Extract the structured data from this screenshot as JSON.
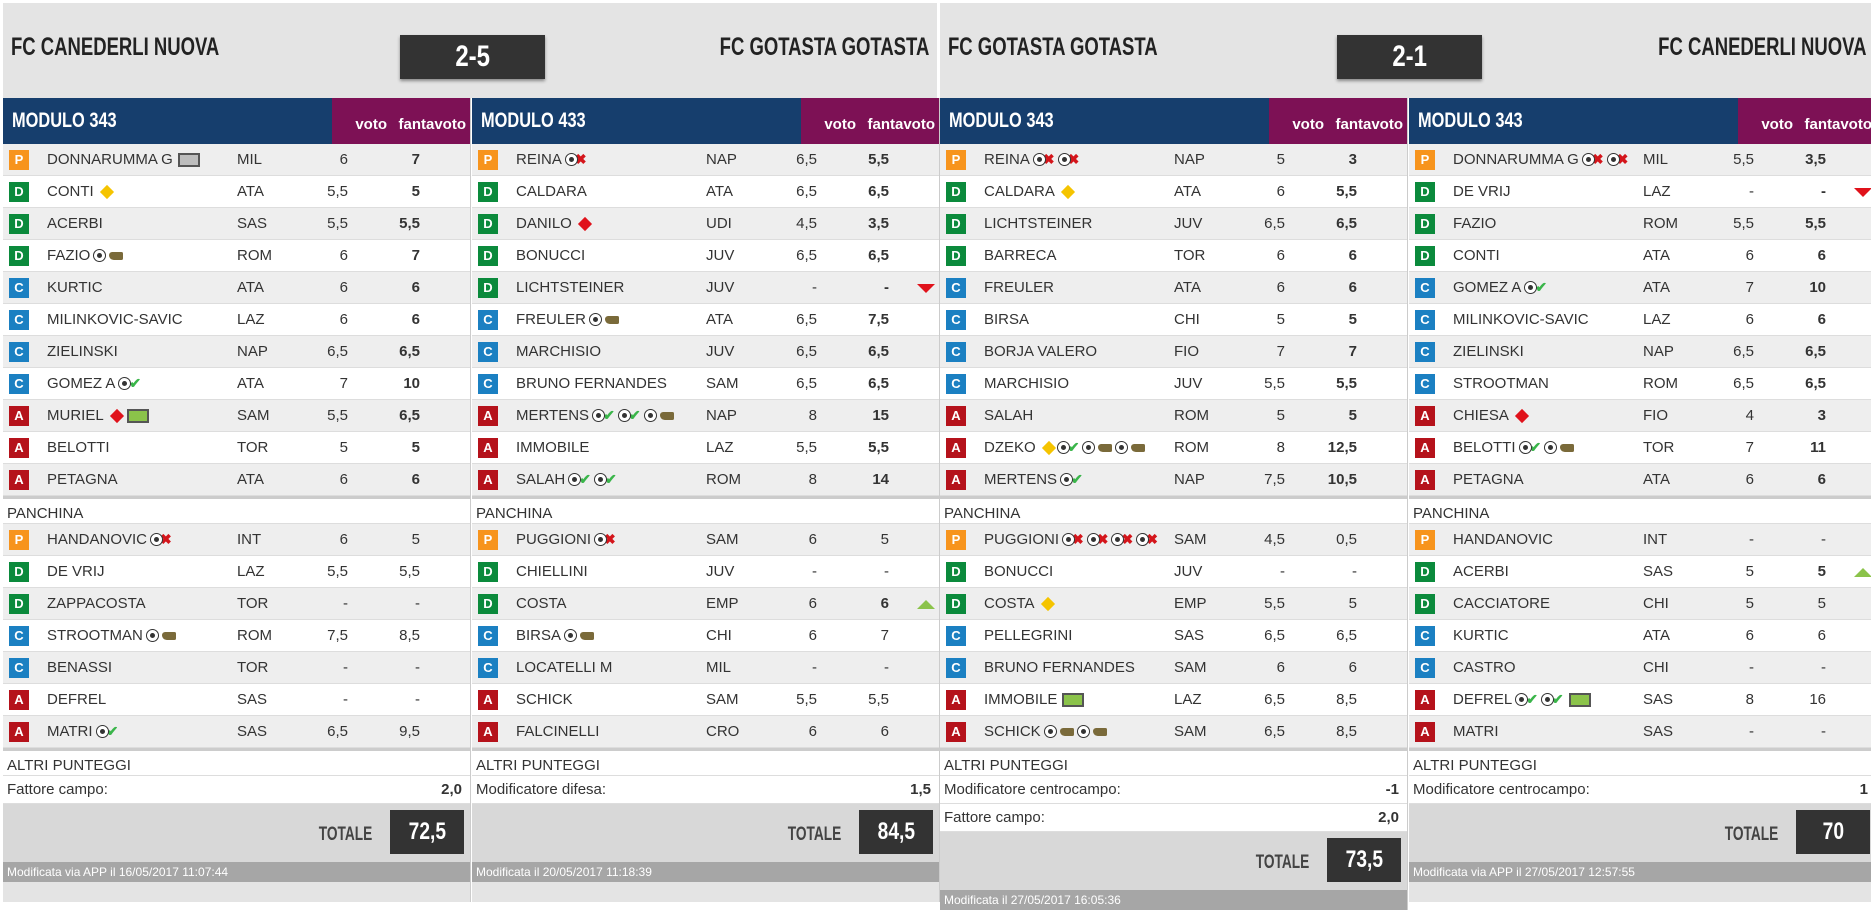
{
  "matches": [
    {
      "home": "FC CANEDERLI NUOVA",
      "away": "FC GOTASTA GOTASTA",
      "score": "2-5",
      "cols": [
        {
          "modulo": "MODULO 343",
          "voto_h": "voto",
          "fv_h": "fantavoto",
          "starters": [
            {
              "r": "P",
              "n": "DONNARUMMA G",
              "ic": [
                "pen-g"
              ],
              "t": "MIL",
              "v": "6",
              "f": "7"
            },
            {
              "r": "D",
              "n": "CONTI",
              "ic": [
                "yc"
              ],
              "t": "ATA",
              "v": "5,5",
              "f": "5"
            },
            {
              "r": "D",
              "n": "ACERBI",
              "ic": [],
              "t": "SAS",
              "v": "5,5",
              "f": "5,5"
            },
            {
              "r": "D",
              "n": "FAZIO",
              "ic": [
                "ball",
                "boot"
              ],
              "t": "ROM",
              "v": "6",
              "f": "7"
            },
            {
              "r": "C",
              "n": "KURTIC",
              "ic": [],
              "t": "ATA",
              "v": "6",
              "f": "6"
            },
            {
              "r": "C",
              "n": "MILINKOVIC-SAVIC",
              "ic": [],
              "t": "LAZ",
              "v": "6",
              "f": "6"
            },
            {
              "r": "C",
              "n": "ZIELINSKI",
              "ic": [],
              "t": "NAP",
              "v": "6,5",
              "f": "6,5"
            },
            {
              "r": "C",
              "n": "GOMEZ A",
              "ic": [
                "ball",
                "chk"
              ],
              "t": "ATA",
              "v": "7",
              "f": "10"
            },
            {
              "r": "A",
              "n": "MURIEL",
              "ic": [
                "rc",
                "pen"
              ],
              "t": "SAM",
              "v": "5,5",
              "f": "6,5"
            },
            {
              "r": "A",
              "n": "BELOTTI",
              "ic": [],
              "t": "TOR",
              "v": "5",
              "f": "5"
            },
            {
              "r": "A",
              "n": "PETAGNA",
              "ic": [],
              "t": "ATA",
              "v": "6",
              "f": "6"
            }
          ],
          "bench_label": "PANCHINA",
          "bench": [
            {
              "r": "P",
              "n": "HANDANOVIC",
              "ic": [
                "ball",
                "x"
              ],
              "t": "INT",
              "v": "6",
              "f": "5"
            },
            {
              "r": "D",
              "n": "DE VRIJ",
              "ic": [],
              "t": "LAZ",
              "v": "5,5",
              "f": "5,5"
            },
            {
              "r": "D",
              "n": "ZAPPACOSTA",
              "ic": [],
              "t": "TOR",
              "v": "-",
              "f": "-"
            },
            {
              "r": "C",
              "n": "STROOTMAN",
              "ic": [
                "ball",
                "boot"
              ],
              "t": "ROM",
              "v": "7,5",
              "f": "8,5"
            },
            {
              "r": "C",
              "n": "BENASSI",
              "ic": [],
              "t": "TOR",
              "v": "-",
              "f": "-"
            },
            {
              "r": "A",
              "n": "DEFREL",
              "ic": [],
              "t": "SAS",
              "v": "-",
              "f": "-"
            },
            {
              "r": "A",
              "n": "MATRI",
              "ic": [
                "ball",
                "chk"
              ],
              "t": "SAS",
              "v": "6,5",
              "f": "9,5"
            }
          ],
          "altri_label": "ALTRI PUNTEGGI",
          "altri": [
            {
              "l": "Fattore campo:",
              "v": "2,0"
            }
          ],
          "totale_label": "TOTALE",
          "totale": "72,5",
          "footer": "Modificata via APP il 16/05/2017 11:07:44"
        },
        {
          "modulo": "MODULO 433",
          "voto_h": "voto",
          "fv_h": "fantavoto",
          "starters": [
            {
              "r": "P",
              "n": "REINA",
              "ic": [
                "ball",
                "x"
              ],
              "t": "NAP",
              "v": "6,5",
              "f": "5,5"
            },
            {
              "r": "D",
              "n": "CALDARA",
              "ic": [],
              "t": "ATA",
              "v": "6,5",
              "f": "6,5"
            },
            {
              "r": "D",
              "n": "DANILO",
              "ic": [
                "rc"
              ],
              "t": "UDI",
              "v": "4,5",
              "f": "3,5"
            },
            {
              "r": "D",
              "n": "BONUCCI",
              "ic": [],
              "t": "JUV",
              "v": "6,5",
              "f": "6,5"
            },
            {
              "r": "D",
              "n": "LICHTSTEINER",
              "ic": [],
              "t": "JUV",
              "v": "-",
              "f": "-",
              "arrow": "dn"
            },
            {
              "r": "C",
              "n": "FREULER",
              "ic": [
                "ball",
                "boot"
              ],
              "t": "ATA",
              "v": "6,5",
              "f": "7,5"
            },
            {
              "r": "C",
              "n": "MARCHISIO",
              "ic": [],
              "t": "JUV",
              "v": "6,5",
              "f": "6,5"
            },
            {
              "r": "C",
              "n": "BRUNO FERNANDES",
              "ic": [],
              "t": "SAM",
              "v": "6,5",
              "f": "6,5"
            },
            {
              "r": "A",
              "n": "MERTENS",
              "ic": [
                "ball",
                "chk",
                "ball",
                "chk",
                "ball",
                "boot"
              ],
              "t": "NAP",
              "v": "8",
              "f": "15"
            },
            {
              "r": "A",
              "n": "IMMOBILE",
              "ic": [],
              "t": "LAZ",
              "v": "5,5",
              "f": "5,5"
            },
            {
              "r": "A",
              "n": "SALAH",
              "ic": [
                "ball",
                "chk",
                "ball",
                "chk"
              ],
              "t": "ROM",
              "v": "8",
              "f": "14"
            }
          ],
          "bench_label": "PANCHINA",
          "bench": [
            {
              "r": "P",
              "n": "PUGGIONI",
              "ic": [
                "ball",
                "x"
              ],
              "t": "SAM",
              "v": "6",
              "f": "5"
            },
            {
              "r": "D",
              "n": "CHIELLINI",
              "ic": [],
              "t": "JUV",
              "v": "-",
              "f": "-"
            },
            {
              "r": "D",
              "n": "COSTA",
              "ic": [],
              "t": "EMP",
              "v": "6",
              "f": "6",
              "bold": true,
              "arrow": "up"
            },
            {
              "r": "C",
              "n": "BIRSA",
              "ic": [
                "ball",
                "boot"
              ],
              "t": "CHI",
              "v": "6",
              "f": "7"
            },
            {
              "r": "C",
              "n": "LOCATELLI M",
              "ic": [],
              "t": "MIL",
              "v": "-",
              "f": "-"
            },
            {
              "r": "A",
              "n": "SCHICK",
              "ic": [],
              "t": "SAM",
              "v": "5,5",
              "f": "5,5"
            },
            {
              "r": "A",
              "n": "FALCINELLI",
              "ic": [],
              "t": "CRO",
              "v": "6",
              "f": "6"
            }
          ],
          "altri_label": "ALTRI PUNTEGGI",
          "altri": [
            {
              "l": "Modificatore difesa:",
              "v": "1,5"
            }
          ],
          "totale_label": "TOTALE",
          "totale": "84,5",
          "footer": "Modificata il 20/05/2017 11:18:39"
        }
      ]
    },
    {
      "home": "FC GOTASTA GOTASTA",
      "away": "FC CANEDERLI NUOVA",
      "score": "2-1",
      "cols": [
        {
          "modulo": "MODULO 343",
          "voto_h": "voto",
          "fv_h": "fantavoto",
          "starters": [
            {
              "r": "P",
              "n": "REINA",
              "ic": [
                "ball",
                "x",
                "ball",
                "x"
              ],
              "t": "NAP",
              "v": "5",
              "f": "3"
            },
            {
              "r": "D",
              "n": "CALDARA",
              "ic": [
                "yc"
              ],
              "t": "ATA",
              "v": "6",
              "f": "5,5"
            },
            {
              "r": "D",
              "n": "LICHTSTEINER",
              "ic": [],
              "t": "JUV",
              "v": "6,5",
              "f": "6,5"
            },
            {
              "r": "D",
              "n": "BARRECA",
              "ic": [],
              "t": "TOR",
              "v": "6",
              "f": "6"
            },
            {
              "r": "C",
              "n": "FREULER",
              "ic": [],
              "t": "ATA",
              "v": "6",
              "f": "6"
            },
            {
              "r": "C",
              "n": "BIRSA",
              "ic": [],
              "t": "CHI",
              "v": "5",
              "f": "5"
            },
            {
              "r": "C",
              "n": "BORJA VALERO",
              "ic": [],
              "t": "FIO",
              "v": "7",
              "f": "7"
            },
            {
              "r": "C",
              "n": "MARCHISIO",
              "ic": [],
              "t": "JUV",
              "v": "5,5",
              "f": "5,5"
            },
            {
              "r": "A",
              "n": "SALAH",
              "ic": [],
              "t": "ROM",
              "v": "5",
              "f": "5"
            },
            {
              "r": "A",
              "n": "DZEKO",
              "ic": [
                "yc",
                "ball",
                "chk",
                "ball",
                "boot",
                "ball",
                "boot"
              ],
              "t": "ROM",
              "v": "8",
              "f": "12,5"
            },
            {
              "r": "A",
              "n": "MERTENS",
              "ic": [
                "ball",
                "chk"
              ],
              "t": "NAP",
              "v": "7,5",
              "f": "10,5"
            }
          ],
          "bench_label": "PANCHINA",
          "bench": [
            {
              "r": "P",
              "n": "PUGGIONI",
              "ic": [
                "ball",
                "x",
                "ball",
                "x",
                "ball",
                "x",
                "ball",
                "x"
              ],
              "t": "SAM",
              "v": "4,5",
              "f": "0,5"
            },
            {
              "r": "D",
              "n": "BONUCCI",
              "ic": [],
              "t": "JUV",
              "v": "-",
              "f": "-"
            },
            {
              "r": "D",
              "n": "COSTA",
              "ic": [
                "yc"
              ],
              "t": "EMP",
              "v": "5,5",
              "f": "5"
            },
            {
              "r": "C",
              "n": "PELLEGRINI",
              "ic": [],
              "t": "SAS",
              "v": "6,5",
              "f": "6,5"
            },
            {
              "r": "C",
              "n": "BRUNO FERNANDES",
              "ic": [],
              "t": "SAM",
              "v": "6",
              "f": "6"
            },
            {
              "r": "A",
              "n": "IMMOBILE",
              "ic": [
                "pen"
              ],
              "t": "LAZ",
              "v": "6,5",
              "f": "8,5"
            },
            {
              "r": "A",
              "n": "SCHICK",
              "ic": [
                "ball",
                "boot",
                "ball",
                "boot"
              ],
              "t": "SAM",
              "v": "6,5",
              "f": "8,5"
            }
          ],
          "altri_label": "ALTRI PUNTEGGI",
          "altri": [
            {
              "l": "Modificatore centrocampo:",
              "v": "-1"
            },
            {
              "l": "Fattore campo:",
              "v": "2,0"
            }
          ],
          "totale_label": "TOTALE",
          "totale": "73,5",
          "footer": "Modificata il 27/05/2017 16:05:36"
        },
        {
          "modulo": "MODULO 343",
          "voto_h": "voto",
          "fv_h": "fantavoto",
          "starters": [
            {
              "r": "P",
              "n": "DONNARUMMA G",
              "ic": [
                "ball",
                "x",
                "ball",
                "x"
              ],
              "t": "MIL",
              "v": "5,5",
              "f": "3,5"
            },
            {
              "r": "D",
              "n": "DE VRIJ",
              "ic": [],
              "t": "LAZ",
              "v": "-",
              "f": "-",
              "arrow": "dn"
            },
            {
              "r": "D",
              "n": "FAZIO",
              "ic": [],
              "t": "ROM",
              "v": "5,5",
              "f": "5,5"
            },
            {
              "r": "D",
              "n": "CONTI",
              "ic": [],
              "t": "ATA",
              "v": "6",
              "f": "6"
            },
            {
              "r": "C",
              "n": "GOMEZ A",
              "ic": [
                "ball",
                "chk"
              ],
              "t": "ATA",
              "v": "7",
              "f": "10"
            },
            {
              "r": "C",
              "n": "MILINKOVIC-SAVIC",
              "ic": [],
              "t": "LAZ",
              "v": "6",
              "f": "6"
            },
            {
              "r": "C",
              "n": "ZIELINSKI",
              "ic": [],
              "t": "NAP",
              "v": "6,5",
              "f": "6,5"
            },
            {
              "r": "C",
              "n": "STROOTMAN",
              "ic": [],
              "t": "ROM",
              "v": "6,5",
              "f": "6,5"
            },
            {
              "r": "A",
              "n": "CHIESA",
              "ic": [
                "rc"
              ],
              "t": "FIO",
              "v": "4",
              "f": "3"
            },
            {
              "r": "A",
              "n": "BELOTTI",
              "ic": [
                "ball",
                "chk",
                "ball",
                "boot"
              ],
              "t": "TOR",
              "v": "7",
              "f": "11"
            },
            {
              "r": "A",
              "n": "PETAGNA",
              "ic": [],
              "t": "ATA",
              "v": "6",
              "f": "6"
            }
          ],
          "bench_label": "PANCHINA",
          "bench": [
            {
              "r": "P",
              "n": "HANDANOVIC",
              "ic": [],
              "t": "INT",
              "v": "-",
              "f": "-"
            },
            {
              "r": "D",
              "n": "ACERBI",
              "ic": [],
              "t": "SAS",
              "v": "5",
              "f": "5",
              "bold": true,
              "arrow": "up"
            },
            {
              "r": "D",
              "n": "CACCIATORE",
              "ic": [],
              "t": "CHI",
              "v": "5",
              "f": "5"
            },
            {
              "r": "C",
              "n": "KURTIC",
              "ic": [],
              "t": "ATA",
              "v": "6",
              "f": "6"
            },
            {
              "r": "C",
              "n": "CASTRO",
              "ic": [],
              "t": "CHI",
              "v": "-",
              "f": "-"
            },
            {
              "r": "A",
              "n": "DEFREL",
              "ic": [
                "ball",
                "chk",
                "ball",
                "chk",
                "pen"
              ],
              "t": "SAS",
              "v": "8",
              "f": "16"
            },
            {
              "r": "A",
              "n": "MATRI",
              "ic": [],
              "t": "SAS",
              "v": "-",
              "f": "-"
            }
          ],
          "altri_label": "ALTRI PUNTEGGI",
          "altri": [
            {
              "l": "Modificatore centrocampo:",
              "v": "1"
            }
          ],
          "totale_label": "TOTALE",
          "totale": "70",
          "footer": "Modificata via APP il 27/05/2017 12:57:55"
        }
      ]
    }
  ]
}
